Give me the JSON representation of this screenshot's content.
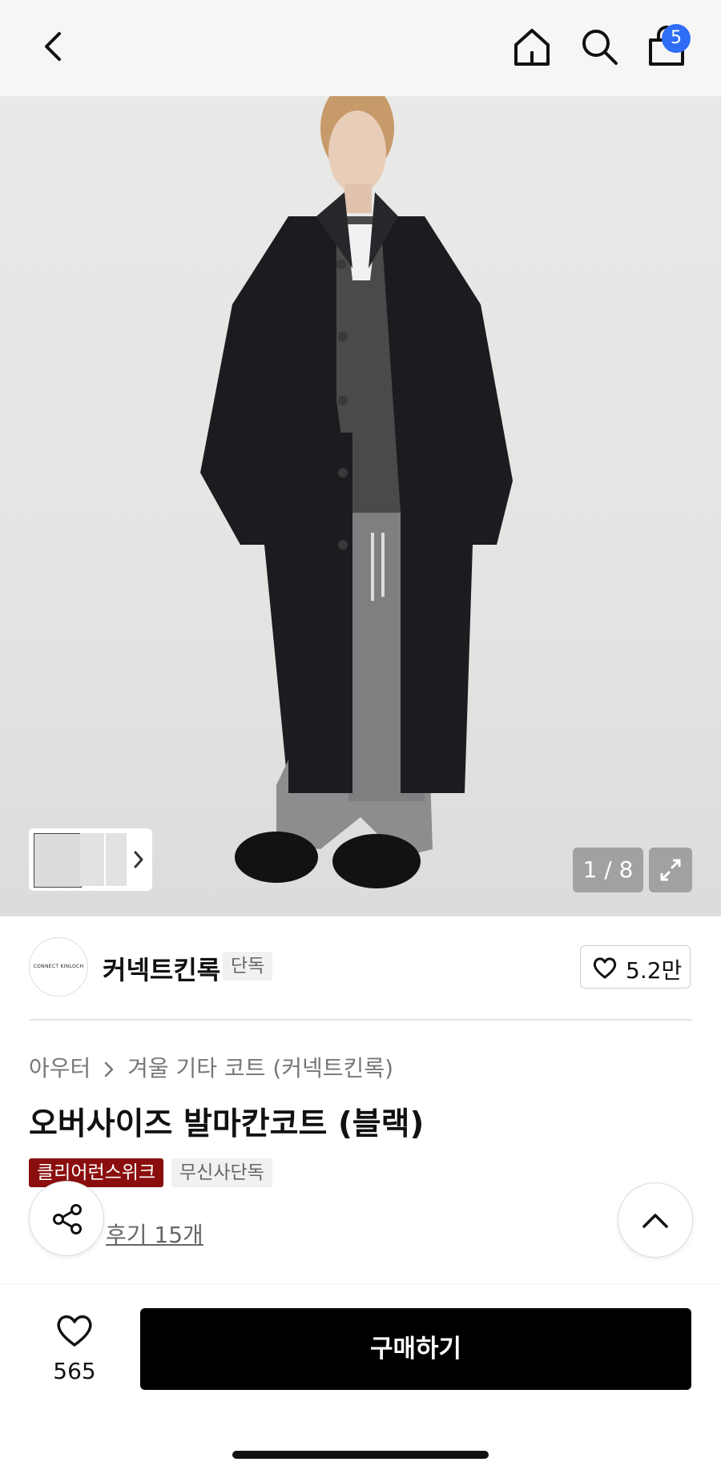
{
  "header": {
    "cart_count": "5",
    "icons": [
      "back-icon",
      "home-icon",
      "search-icon",
      "cart-icon"
    ]
  },
  "gallery": {
    "counter": "1 / 8",
    "icons": [
      "chevron-right-icon",
      "expand-icon"
    ]
  },
  "brand": {
    "logo_text": "CONNECT KINLOCH",
    "name": "커넥트킨록",
    "exclusive_tag": "단독",
    "like_count": "5.2만"
  },
  "product": {
    "breadcrumb": [
      "아우터",
      "겨울 기타 코트 (커넥트킨록)"
    ],
    "title": "오버사이즈 발마칸코트 (블랙)",
    "tags": [
      "클리어런스위크",
      "무신사단독"
    ],
    "review_link": "후기 15개"
  },
  "bottom": {
    "wish_count": "565",
    "buy_label": "구매하기"
  },
  "colors": {
    "badge": "#2f6df6",
    "clearance_tag": "#8b0e0e",
    "buy_button": "#000000"
  }
}
